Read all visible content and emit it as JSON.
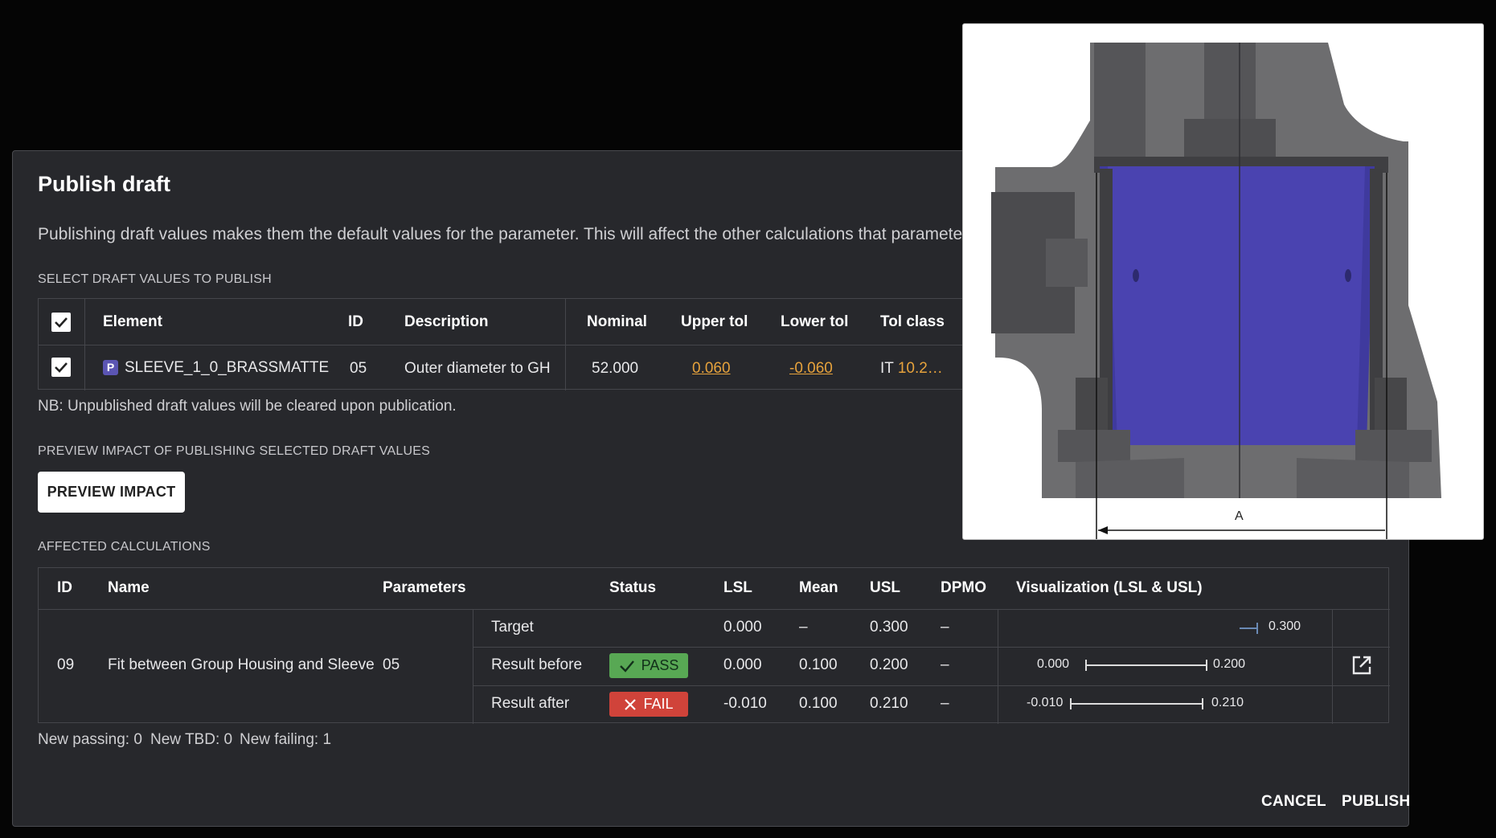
{
  "dialog": {
    "title": "Publish draft",
    "intro": "Publishing draft values makes them the default values for the parameter. This will affect the other calculations that parameter is us",
    "select_label": "SELECT DRAFT VALUES TO PUBLISH",
    "note": "NB: Unpublished draft values will be cleared upon publication.",
    "preview_label": "PREVIEW IMPACT OF PUBLISHING SELECTED DRAFT VALUES",
    "preview_button": "PREVIEW IMPACT",
    "affected_label": "AFFECTED CALCULATIONS",
    "cancel": "CANCEL",
    "publish": "PUBLISH"
  },
  "draft_table": {
    "headers": {
      "element": "Element",
      "id": "ID",
      "description": "Description",
      "nominal": "Nominal",
      "upper_tol": "Upper tol",
      "lower_tol": "Lower tol",
      "tol_class": "Tol class"
    },
    "row": {
      "badge": "P",
      "element": "SLEEVE_1_0_BRASSMATTE",
      "id": "05",
      "description": "Outer diameter to GH",
      "nominal": "52.000",
      "upper_tol": "0.060",
      "lower_tol": "-0.060",
      "tol_class_prefix": "IT",
      "tol_class_value": "10.2…",
      "checked": true
    }
  },
  "calc_table": {
    "headers": {
      "id": "ID",
      "name": "Name",
      "parameters": "Parameters",
      "status": "Status",
      "lsl": "LSL",
      "mean": "Mean",
      "usl": "USL",
      "dpmo": "DPMO",
      "visualization": "Visualization (LSL & USL)"
    },
    "calc": {
      "id": "09",
      "name": "Fit between Group Housing and Sleeve",
      "parameters": "05"
    },
    "rows": [
      {
        "label": "Target",
        "status": "",
        "lsl": "0.000",
        "mean": "–",
        "usl": "0.300",
        "dpmo": "–",
        "vis_lsl": "",
        "vis_usl": "0.300"
      },
      {
        "label": "Result before",
        "status": "PASS",
        "lsl": "0.000",
        "mean": "0.100",
        "usl": "0.200",
        "dpmo": "–",
        "vis_lsl": "0.000",
        "vis_usl": "0.200"
      },
      {
        "label": "Result after",
        "status": "FAIL",
        "lsl": "-0.010",
        "mean": "0.100",
        "usl": "0.210",
        "dpmo": "–",
        "vis_lsl": "-0.010",
        "vis_usl": "0.210"
      }
    ]
  },
  "summary": {
    "new_passing": "New passing: 0",
    "new_tbd": "New TBD: 0",
    "new_failing": "New failing: 1"
  },
  "drawing": {
    "dimension_label": "A"
  },
  "colors": {
    "pass": "#58a854",
    "fail": "#d0433a",
    "accent_orange": "#e6a23c",
    "part_purple": "#3f3a9e"
  }
}
